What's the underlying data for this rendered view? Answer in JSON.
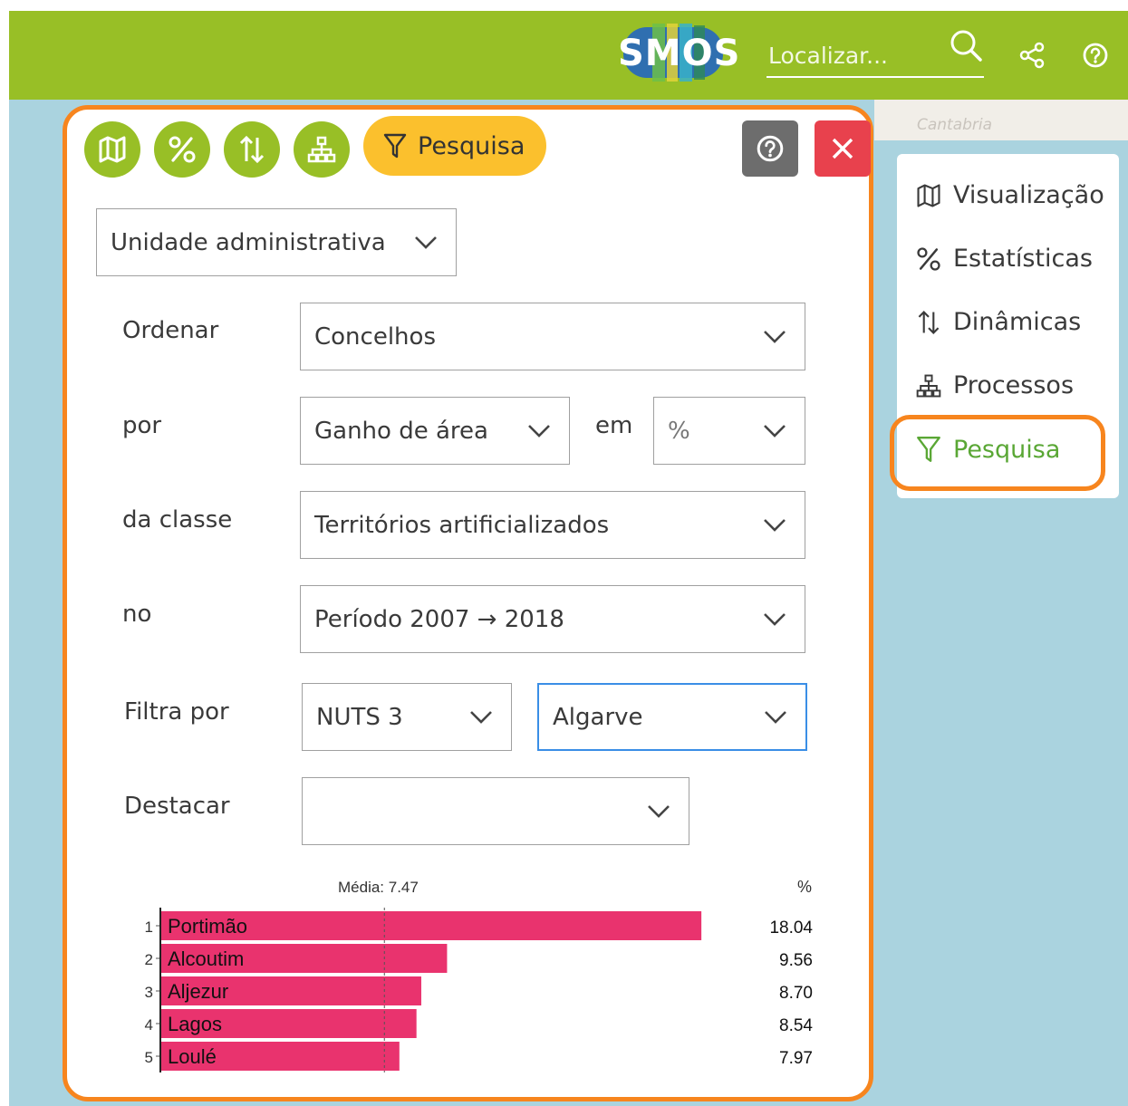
{
  "header": {
    "logo_text": "SMOS",
    "search_placeholder": "Localizar...",
    "bg_color": "#98bf26"
  },
  "map": {
    "label": "Cantabria"
  },
  "panel": {
    "mode_buttons": [
      {
        "icon": "map-icon"
      },
      {
        "icon": "percent-icon"
      },
      {
        "icon": "sort-arrows-icon"
      },
      {
        "icon": "hierarchy-icon"
      }
    ],
    "active_tab_label": "Pesquisa",
    "unit_select": "Unidade administrativa",
    "form": {
      "ordenar_label": "Ordenar",
      "ordenar_value": "Concelhos",
      "por_label": "por",
      "por_value": "Ganho de área",
      "em_label": "em",
      "em_value": "%",
      "classe_label": "da classe",
      "classe_value": "Territórios artificializados",
      "no_label": "no",
      "no_value": "Período 2007 → 2018",
      "filtra_label": "Filtra por",
      "filtra_level": "NUTS 3",
      "filtra_region": "Algarve",
      "destacar_label": "Destacar",
      "destacar_value": ""
    }
  },
  "chart_data": {
    "type": "bar",
    "orientation": "horizontal",
    "mean_label": "Média: 7.47",
    "mean": 7.47,
    "unit_label": "%",
    "ranks": [
      "1",
      "2",
      "3",
      "4",
      "5"
    ],
    "categories": [
      "Portimão",
      "Alcoutim",
      "Aljezur",
      "Lagos",
      "Loulé"
    ],
    "values": [
      18.04,
      9.56,
      8.7,
      8.54,
      7.97
    ],
    "value_labels": [
      "18.04",
      "9.56",
      "8.70",
      "8.54",
      "7.97"
    ],
    "bar_color": "#e9336e"
  },
  "sidebar": {
    "items": [
      {
        "label": "Visualização",
        "icon": "map-icon"
      },
      {
        "label": "Estatísticas",
        "icon": "percent-icon"
      },
      {
        "label": "Dinâmicas",
        "icon": "sort-arrows-icon"
      },
      {
        "label": "Processos",
        "icon": "hierarchy-icon"
      },
      {
        "label": "Pesquisa",
        "icon": "filter-icon"
      }
    ],
    "active_color": "#5aa735"
  },
  "colors": {
    "highlight_orange": "#f7851e",
    "accent_yellow": "#fbc02d",
    "close_red": "#e8414d",
    "focus_blue": "#3a8ee6"
  }
}
